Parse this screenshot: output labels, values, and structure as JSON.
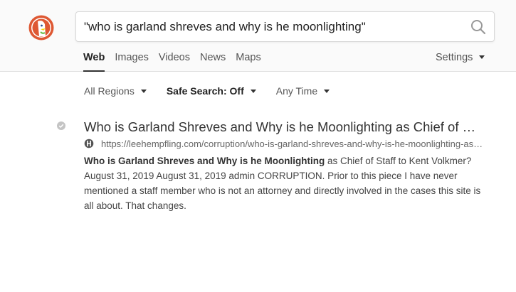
{
  "search": {
    "query": "\"who is garland shreves and why is he moonlighting\""
  },
  "nav": {
    "tabs": [
      "Web",
      "Images",
      "Videos",
      "News",
      "Maps"
    ],
    "active": "Web",
    "settings": "Settings"
  },
  "filters": {
    "region": "All Regions",
    "safe_search": "Safe Search: Off",
    "time": "Any Time"
  },
  "results": [
    {
      "title": "Who is Garland Shreves and Why is he Moonlighting as Chief of Staff to Kent Volkmer?",
      "url": "https://leehempfling.com/corruption/who-is-garland-shreves-and-why-is-he-moonlighting-as-chief-of-staff-to-kent-volkmer/",
      "snippet_bold": "Who is Garland Shreves and Why is he Moonlighting",
      "snippet_rest": " as Chief of Staff to Kent Volkmer? August 31, 2019 August 31, 2019 admin CORRUPTION. Prior to this piece I have never mentioned a staff member who is not an attorney and directly involved in the cases this site is all about. That changes."
    }
  ],
  "colors": {
    "logo_orange": "#de5833",
    "accent": "#333333",
    "link": "#333333",
    "url": "#666666"
  },
  "icons": {
    "logo": "duckduckgo-logo",
    "search": "search-icon",
    "check": "check-icon",
    "favicon": "globe-favicon"
  }
}
